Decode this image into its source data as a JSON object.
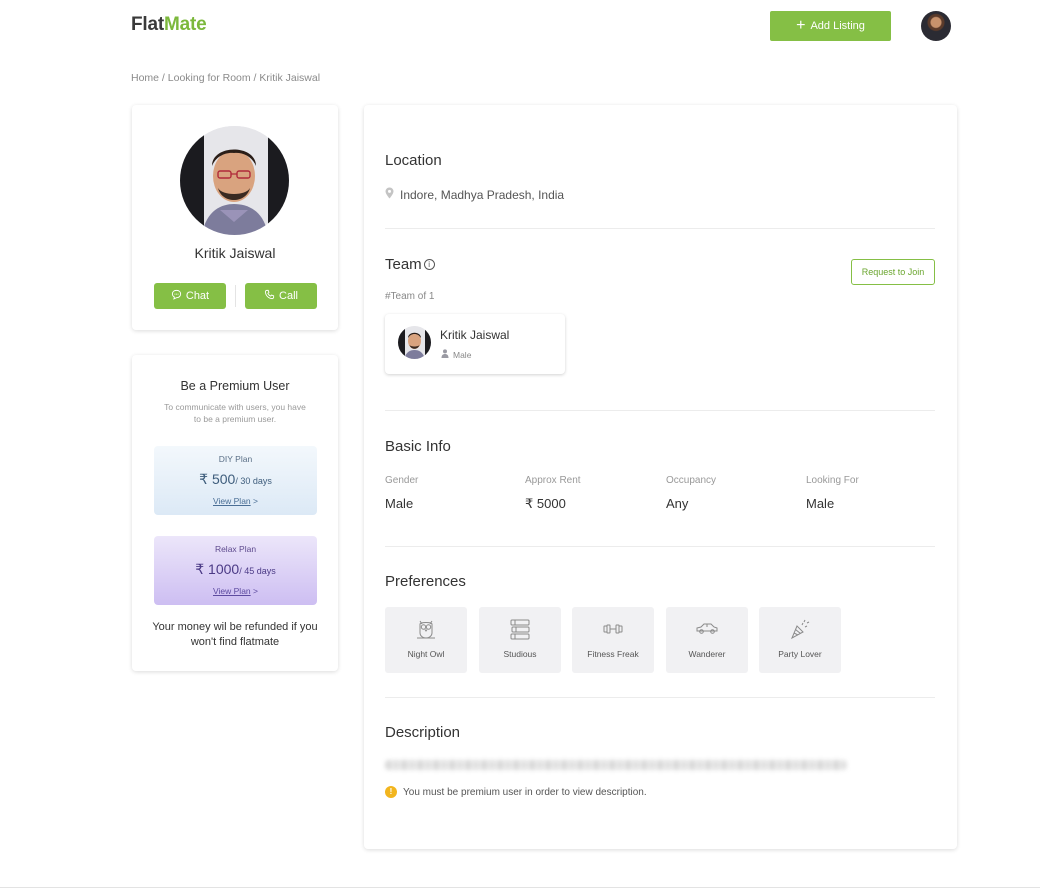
{
  "header": {
    "logo_part1": "Flat",
    "logo_part2": "Mate",
    "add_listing_label": "Add Listing",
    "colors": {
      "brand_green": "#85bf45",
      "logo_dark": "#3a3a3a"
    }
  },
  "breadcrumb": "Home / Looking for Room / Kritik Jaiswal",
  "profile": {
    "name": "Kritik Jaiswal",
    "chat_label": "Chat",
    "call_label": "Call"
  },
  "premium": {
    "title": "Be a Premium User",
    "subtitle": "To communicate with users, you have to be a premium user.",
    "plans": [
      {
        "name": "DIY Plan",
        "price": "₹ 500",
        "period": "/ 30 days",
        "link": "View Plan"
      },
      {
        "name": "Relax Plan",
        "price": "₹ 1000",
        "period": "/ 45 days",
        "link": "View Plan"
      }
    ],
    "refund_note": "Your money wil be refunded if you won't find flatmate"
  },
  "location": {
    "title": "Location",
    "address": "Indore, Madhya Pradesh, India"
  },
  "team": {
    "title": "Team",
    "request_label": "Request to Join",
    "count_label": "#Team of 1",
    "members": [
      {
        "name": "Kritik Jaiswal",
        "gender": "Male"
      }
    ]
  },
  "basic_info": {
    "title": "Basic Info",
    "fields": [
      {
        "label": "Gender",
        "value": "Male"
      },
      {
        "label": "Approx Rent",
        "value": "₹ 5000"
      },
      {
        "label": "Occupancy",
        "value": "Any"
      },
      {
        "label": "Looking For",
        "value": "Male"
      }
    ]
  },
  "preferences": {
    "title": "Preferences",
    "items": [
      {
        "label": "Night Owl",
        "icon": "owl-icon"
      },
      {
        "label": "Studious",
        "icon": "books-icon"
      },
      {
        "label": "Fitness Freak",
        "icon": "dumbbell-icon"
      },
      {
        "label": "Wanderer",
        "icon": "car-icon"
      },
      {
        "label": "Party Lover",
        "icon": "party-popper-icon"
      }
    ]
  },
  "description": {
    "title": "Description",
    "premium_note": "You must be premium user in order to view description."
  }
}
